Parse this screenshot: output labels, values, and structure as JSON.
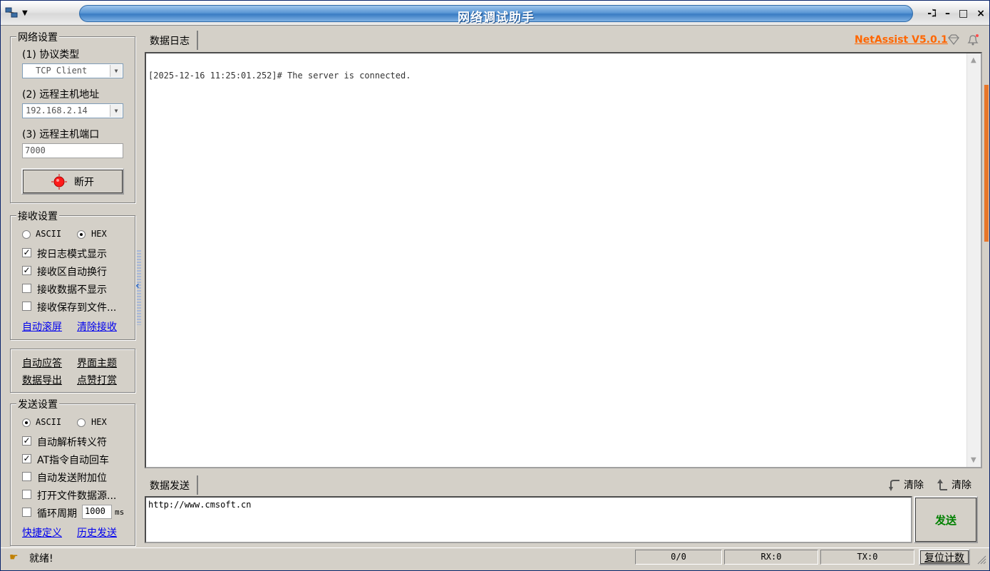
{
  "window": {
    "title": "网络调试助手",
    "pin_glyph": "-ℷ",
    "min_glyph": "–",
    "max_glyph": "□",
    "close_glyph": "×"
  },
  "network": {
    "group_label": "网络设置",
    "protocol_label": "(1) 协议类型",
    "protocol_value": "TCP Client",
    "host_label": "(2) 远程主机地址",
    "host_value": "192.168.2.14",
    "port_label": "(3) 远程主机端口",
    "port_value": "7000",
    "disconnect_label": "断开"
  },
  "receive": {
    "group_label": "接收设置",
    "ascii_label": "ASCII",
    "hex_label": "HEX",
    "mode": "HEX",
    "options": [
      {
        "label": "按日志模式显示",
        "checked": true
      },
      {
        "label": "接收区自动换行",
        "checked": true
      },
      {
        "label": "接收数据不显示",
        "checked": false
      },
      {
        "label": "接收保存到文件...",
        "checked": false
      }
    ],
    "auto_scroll_label": "自动滚屏",
    "clear_label": "清除接收"
  },
  "tools": {
    "auto_reply": "自动应答",
    "theme": "界面主题",
    "export": "数据导出",
    "donate": "点赞打赏"
  },
  "send": {
    "group_label": "发送设置",
    "ascii_label": "ASCII",
    "hex_label": "HEX",
    "mode": "ASCII",
    "options": [
      {
        "label": "自动解析转义符",
        "checked": true
      },
      {
        "label": "AT指令自动回车",
        "checked": true
      },
      {
        "label": "自动发送附加位",
        "checked": false
      },
      {
        "label": "打开文件数据源...",
        "checked": false
      }
    ],
    "cycle_label": "循环周期",
    "cycle_value": "1000",
    "cycle_unit": "ms",
    "shortcut_label": "快捷定义",
    "history_label": "历史发送"
  },
  "log": {
    "tab_label": "数据日志",
    "brand": "NetAssist V5.0.1",
    "lines": [
      "[2025-12-16 11:25:01.252]# The server is connected."
    ]
  },
  "data_send": {
    "tab_label": "数据发送",
    "clear1_label": "清除",
    "clear2_label": "清除",
    "input_value": "http://www.cmsoft.cn",
    "send_label": "发送"
  },
  "status": {
    "ready": "就绪!",
    "count": "0/0",
    "rx": "RX:0",
    "tx": "TX:0",
    "reset": "复位计数"
  },
  "colors": {
    "title_blue": "#3a7cc3",
    "brand_orange": "#ff6600",
    "send_green": "#008000",
    "scroll_accent": "#e8762a"
  }
}
